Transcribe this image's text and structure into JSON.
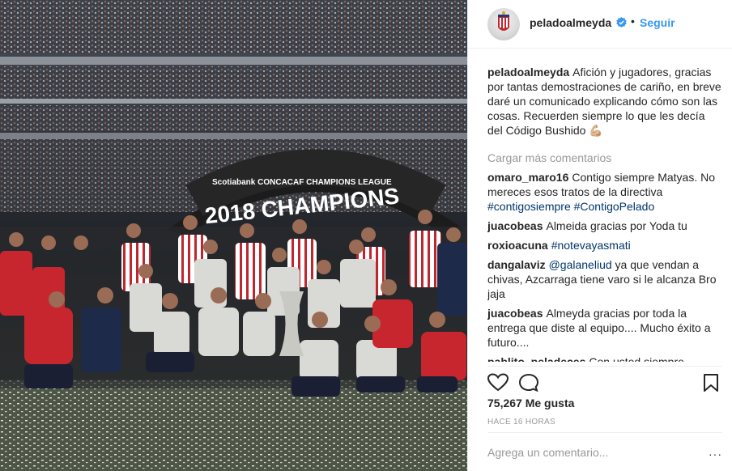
{
  "post": {
    "image_banner_brand": "Scotiabank CONCACAF CHAMPIONS LEAGUE",
    "image_banner_text": "2018 CHAMPIONS"
  },
  "header": {
    "username": "peladoalmeyda",
    "separator": "•",
    "follow_label": "Seguir"
  },
  "caption": {
    "user": "peladoalmeyda",
    "text": "Afición y jugadores, gracias por tantas demostraciones de cariño, en breve daré un comunicado explicando cómo son las cosas. Recuerden siempre lo que les decía del Código Bushido 💪🏼"
  },
  "load_more_label": "Cargar más comentarios",
  "comments": [
    {
      "user": "omaro_maro16",
      "text": "Contigo siempre Matyas. No mereces esos tratos de la directiva",
      "tags": [
        "#contigosiempre",
        "#ContigoPelado"
      ]
    },
    {
      "user": "juacobeas",
      "text": "Almeida gracias por Yoda tu"
    },
    {
      "user": "roxioacuna",
      "text": "",
      "tags": [
        "#notevayasmati"
      ]
    },
    {
      "user": "dangalaviz",
      "mention": "@galaneliud",
      "text": "ya que vendan a chivas, Azcarraga tiene varo si le alcanza Bro jaja"
    },
    {
      "user": "juacobeas",
      "text": "Almeyda gracias por toda la entrega que diste al equipo.... Mucho éxito a futuro...."
    },
    {
      "user": "pablito_peladeces",
      "text": "Con usted siempre"
    }
  ],
  "actions": {
    "like_icon": "heart-icon",
    "comment_icon": "comment-bubble-icon",
    "save_icon": "bookmark-icon"
  },
  "likes_label": "75,267 Me gusta",
  "timestamp": "HACE 16 HORAS",
  "add_comment": {
    "placeholder": "Agrega un comentario...",
    "more_label": "···"
  },
  "colors": {
    "link_blue": "#3897f0",
    "hashtag": "#003569",
    "muted": "#999999",
    "text": "#262626"
  }
}
